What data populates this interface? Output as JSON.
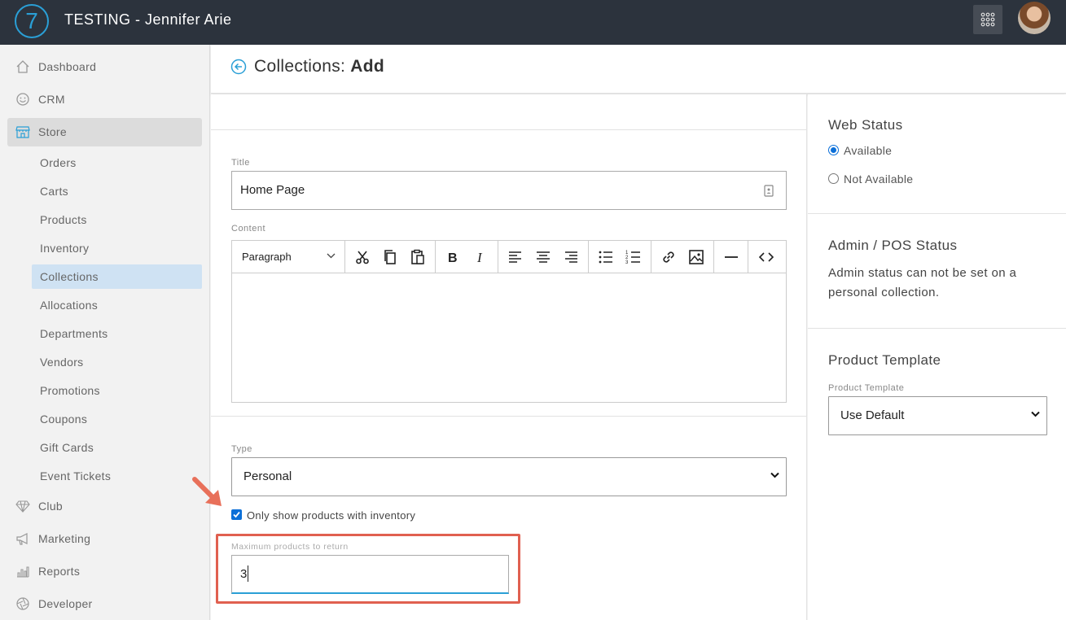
{
  "topbar": {
    "logo_text": "7",
    "app_title": "TESTING - Jennifer Arie"
  },
  "sidebar": {
    "items": [
      {
        "label": "Dashboard",
        "icon": "home-icon"
      },
      {
        "label": "CRM",
        "icon": "smiley-icon"
      },
      {
        "label": "Store",
        "icon": "store-icon"
      },
      {
        "label": "Club",
        "icon": "diamond-icon"
      },
      {
        "label": "Marketing",
        "icon": "megaphone-icon"
      },
      {
        "label": "Reports",
        "icon": "bar-chart-icon"
      },
      {
        "label": "Developer",
        "icon": "aperture-icon"
      }
    ],
    "store_subitems": [
      "Orders",
      "Carts",
      "Products",
      "Inventory",
      "Collections",
      "Allocations",
      "Departments",
      "Vendors",
      "Promotions",
      "Coupons",
      "Gift Cards",
      "Event Tickets"
    ],
    "active_item": "Store",
    "active_subitem": "Collections"
  },
  "header": {
    "title_prefix": "Collections: ",
    "title_bold": "Add"
  },
  "form": {
    "title_label": "Title",
    "title_value": "Home Page",
    "content_label": "Content",
    "editor": {
      "block_format": "Paragraph",
      "tools": [
        "cut-icon",
        "copy-icon",
        "paste-icon",
        "bold-icon",
        "italic-icon",
        "align-left-icon",
        "align-center-icon",
        "align-right-icon",
        "bullet-list-icon",
        "numbered-list-icon",
        "link-icon",
        "image-icon",
        "horizontal-rule-icon",
        "code-icon"
      ]
    },
    "type_label": "Type",
    "type_value": "Personal",
    "inventory_checkbox_label": "Only show products with inventory",
    "inventory_checked": true,
    "max_products_label": "Maximum products to return",
    "max_products_value": "3"
  },
  "right_panel": {
    "web_status": {
      "heading": "Web Status",
      "options": [
        "Available",
        "Not Available"
      ],
      "selected": "Available"
    },
    "admin_status": {
      "heading": "Admin / POS Status",
      "text": "Admin status can not be set on a personal collection."
    },
    "product_template": {
      "heading": "Product Template",
      "label": "Product Template",
      "value": "Use Default"
    }
  },
  "colors": {
    "topbar": "#2c333d",
    "accent": "#2a9fd6",
    "active_subitem_bg": "#cfe2f3",
    "highlight_border": "#e06050",
    "annotation_arrow": "#e8705a"
  }
}
